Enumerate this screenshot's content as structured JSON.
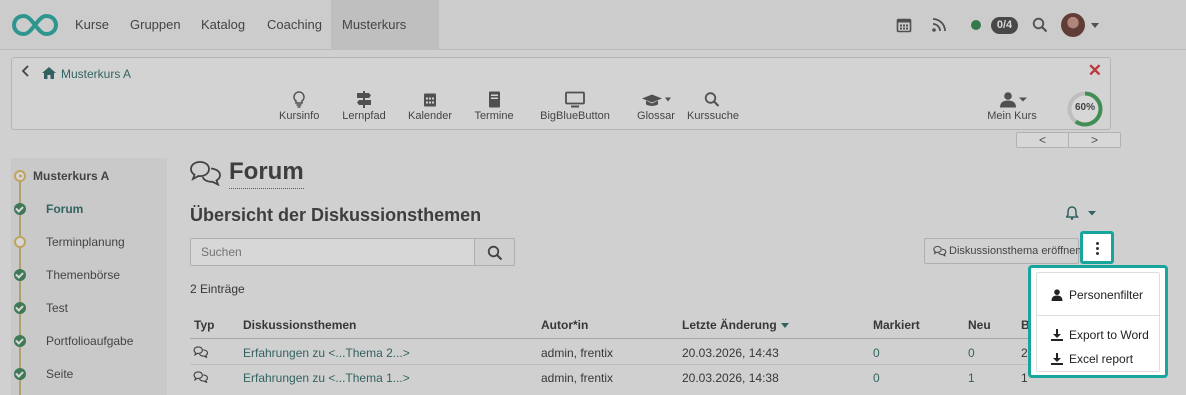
{
  "topnav": {
    "items": [
      "Kurse",
      "Gruppen",
      "Katalog",
      "Coaching"
    ],
    "active_tab": "Musterkurs A",
    "active_close": "✕",
    "badge": "0/4"
  },
  "course_panel": {
    "breadcrumb": "Musterkurs A",
    "close": "✕",
    "tools": [
      "Kursinfo",
      "Lernpfad",
      "Kalender",
      "Termine",
      "BigBlueButton",
      "Glossar",
      "Kurssuche"
    ],
    "my_course": "Mein Kurs",
    "progress_label": "60%",
    "progress_value": 0.6,
    "pager_prev": "<",
    "pager_next": ">"
  },
  "menu": {
    "items": [
      {
        "label": "Musterkurs A",
        "state": "start",
        "bold": true,
        "active": false
      },
      {
        "label": "Forum",
        "state": "done",
        "bold": true,
        "active": true
      },
      {
        "label": "Terminplanung",
        "state": "open",
        "bold": false,
        "active": false
      },
      {
        "label": "Themenbörse",
        "state": "done",
        "bold": false,
        "active": false
      },
      {
        "label": "Test",
        "state": "done",
        "bold": false,
        "active": false
      },
      {
        "label": "Portfolioaufgabe",
        "state": "done",
        "bold": false,
        "active": false
      },
      {
        "label": "Seite",
        "state": "done",
        "bold": false,
        "active": false
      }
    ]
  },
  "main": {
    "title": "Forum",
    "subtitle": "Übersicht der Diskussionsthemen",
    "search_placeholder": "Suchen",
    "open_thread_button": "Diskussionsthema eröffnen",
    "entries": "2 Einträge",
    "table": {
      "headers": [
        "Typ",
        "Diskussionsthemen",
        "Autor*in",
        "Letzte Änderung",
        "Markiert",
        "Neu",
        "Be"
      ],
      "rows": [
        {
          "topic": "Erfahrungen zu <...Thema 2...>",
          "author": "admin, frentix",
          "changed": "20.03.2026, 14:43",
          "marked": "0",
          "new": "0",
          "be": "2"
        },
        {
          "topic": "Erfahrungen zu <...Thema 1...>",
          "author": "admin, frentix",
          "changed": "20.03.2026, 14:38",
          "marked": "0",
          "new": "1",
          "be": "1"
        }
      ]
    }
  },
  "dropdown": {
    "items": [
      "Personenfilter",
      "Export to Word",
      "Excel report"
    ]
  },
  "colors": {
    "accent": "#17a59c",
    "link": "#1b5e5a",
    "close": "#d4232a",
    "status": "#1e7d3c"
  }
}
